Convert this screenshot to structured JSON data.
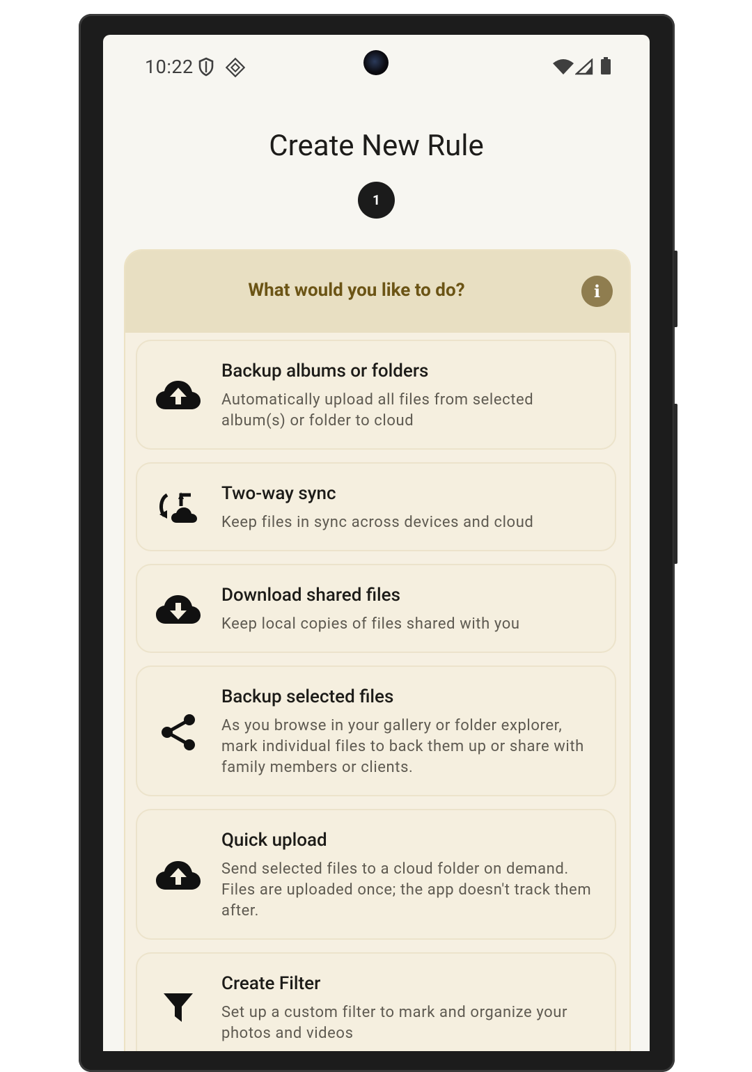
{
  "status_bar": {
    "time": "10:22",
    "left_icons": [
      "shield-icon",
      "vpn-diamond-icon"
    ],
    "right_icons": [
      "wifi-icon",
      "cell-signal-icon",
      "battery-icon"
    ]
  },
  "page": {
    "title": "Create New Rule",
    "step_number": "1"
  },
  "card": {
    "question": "What would you like to do?",
    "info_icon": "info-icon",
    "options": [
      {
        "icon": "cloud-upload-icon",
        "title": "Backup albums or folders",
        "description": "Automatically upload all files from selected album(s) or folder to cloud"
      },
      {
        "icon": "two-way-sync-icon",
        "title": "Two-way sync",
        "description": "Keep files in sync across devices and cloud"
      },
      {
        "icon": "cloud-download-icon",
        "title": "Download shared files",
        "description": "Keep local copies of files shared with you"
      },
      {
        "icon": "share-icon",
        "title": "Backup selected files",
        "description": "As you browse in your gallery or folder explorer, mark individual files to back them up or share with family members or clients."
      },
      {
        "icon": "cloud-upload-icon",
        "title": "Quick upload",
        "description": "Send selected files to a cloud folder on demand. Files are uploaded once; the app doesn't track them after."
      },
      {
        "icon": "filter-icon",
        "title": "Create Filter",
        "description": "Set up a custom filter to mark and organize your photos and videos"
      }
    ]
  },
  "colors": {
    "screen_bg": "#f7f6f1",
    "card_bg": "#f6f0e2",
    "card_header_bg": "#e8dfc2",
    "question_text": "#6b5415",
    "info_button": "#8f7d4f",
    "step_badge": "#1b1b1b"
  }
}
